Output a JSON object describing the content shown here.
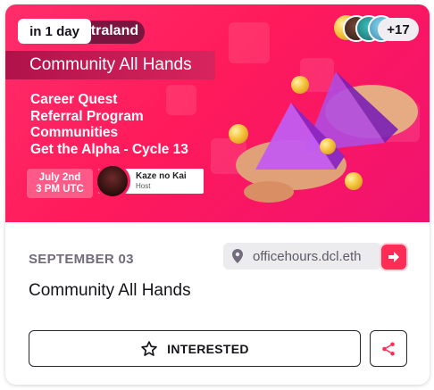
{
  "banner": {
    "brand_suffix": "ntraland",
    "title": "Community All Hands",
    "agenda": [
      "Career Quest",
      "Referral Program",
      "Communities",
      "Get the Alpha - Cycle 13"
    ],
    "date_line1": "July 2nd",
    "date_line2": "3 PM UTC",
    "host_name": "Kaze no Kai",
    "host_role": "Host"
  },
  "badge": {
    "label": "in 1 day"
  },
  "attendees": {
    "more_label": "+17"
  },
  "event": {
    "date": "SEPTEMBER 03",
    "location": "officehours.dcl.eth",
    "title": "Community All Hands"
  },
  "actions": {
    "interested_label": "INTERESTED"
  },
  "colors": {
    "accent": "#ff2d55",
    "banner": "#ff1a5b",
    "text": "#16141a",
    "muted": "#716b7c"
  },
  "icons": {
    "location": "pin-icon",
    "jump": "jump-in-icon",
    "interested": "star-icon",
    "share": "share-icon"
  }
}
